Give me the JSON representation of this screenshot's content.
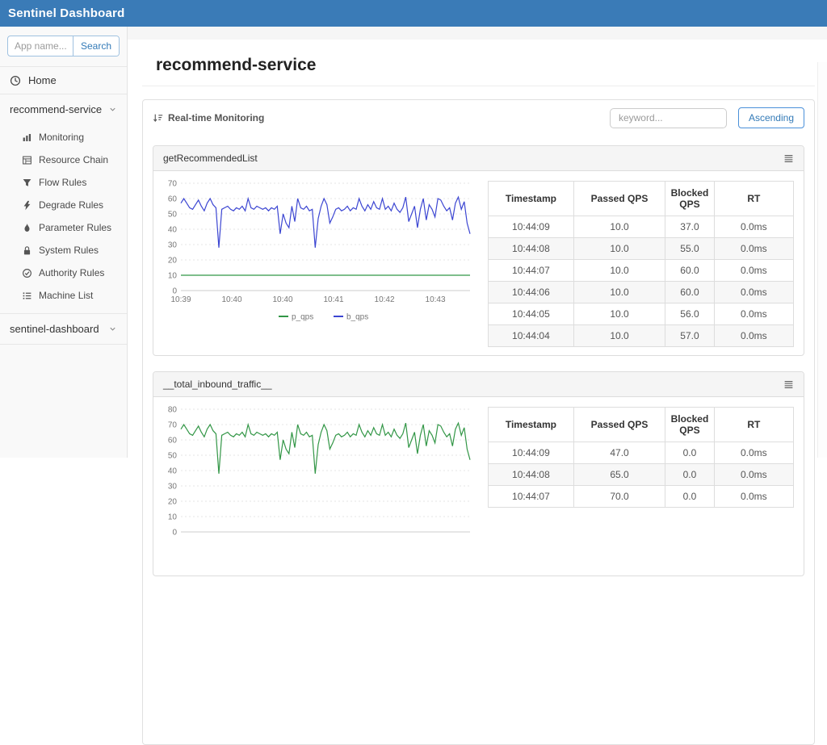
{
  "header": {
    "title": "Sentinel Dashboard"
  },
  "sidebar": {
    "search_placeholder": "App name...",
    "search_button": "Search",
    "home_label": "Home",
    "app_groups": [
      {
        "label": "recommend-service",
        "icon": "chevron-down",
        "expanded": true
      },
      {
        "label": "sentinel-dashboard",
        "icon": "chevron-down",
        "expanded": false
      }
    ],
    "menu_items": [
      {
        "label": "Monitoring",
        "icon": "bar-chart"
      },
      {
        "label": "Resource Chain",
        "icon": "table"
      },
      {
        "label": "Flow Rules",
        "icon": "funnel"
      },
      {
        "label": "Degrade Rules",
        "icon": "bolt"
      },
      {
        "label": "Parameter Rules",
        "icon": "flame"
      },
      {
        "label": "System Rules",
        "icon": "lock"
      },
      {
        "label": "Authority Rules",
        "icon": "check-circle"
      },
      {
        "label": "Machine List",
        "icon": "list"
      }
    ]
  },
  "main": {
    "page_title": "recommend-service",
    "toolbar": {
      "title": "Real-time Monitoring",
      "icon": "sort-amount-asc",
      "keyword_placeholder": "keyword...",
      "ascending_label": "Ascending"
    }
  },
  "panels": [
    {
      "title": "getRecommendedList",
      "menu_icon": "menu",
      "table": {
        "headers": [
          "Timestamp",
          "Passed QPS",
          "Blocked QPS",
          "RT"
        ],
        "rows": [
          [
            "10:44:09",
            "10.0",
            "37.0",
            "0.0ms"
          ],
          [
            "10:44:08",
            "10.0",
            "55.0",
            "0.0ms"
          ],
          [
            "10:44:07",
            "10.0",
            "60.0",
            "0.0ms"
          ],
          [
            "10:44:06",
            "10.0",
            "60.0",
            "0.0ms"
          ],
          [
            "10:44:05",
            "10.0",
            "56.0",
            "0.0ms"
          ],
          [
            "10:44:04",
            "10.0",
            "57.0",
            "0.0ms"
          ]
        ]
      }
    },
    {
      "title": "__total_inbound_traffic__",
      "menu_icon": "menu",
      "table": {
        "headers": [
          "Timestamp",
          "Passed QPS",
          "Blocked QPS",
          "RT"
        ],
        "rows": [
          [
            "10:44:09",
            "47.0",
            "0.0",
            "0.0ms"
          ],
          [
            "10:44:08",
            "65.0",
            "0.0",
            "0.0ms"
          ],
          [
            "10:44:07",
            "70.0",
            "0.0",
            "0.0ms"
          ]
        ]
      }
    }
  ],
  "chart_data": [
    {
      "type": "line",
      "title": "getRecommendedList QPS",
      "ylim": [
        0,
        70
      ],
      "yticks": [
        70,
        60,
        50,
        40,
        30,
        20,
        10,
        0
      ],
      "x_labels": [
        "10:39",
        "10:40",
        "10:40",
        "10:41",
        "10:42",
        "10:43"
      ],
      "grid": "dotted",
      "show_legend": true,
      "legend_position": "bottom",
      "series": [
        {
          "name": "p_qps",
          "color": "#329646",
          "values": [
            10,
            10
          ]
        },
        {
          "name": "b_qps",
          "color": "#3c46d2",
          "values": [
            57,
            60,
            57,
            54,
            53,
            56,
            59,
            55,
            52,
            57,
            60,
            56,
            54,
            28,
            53,
            54,
            55,
            53,
            52,
            54,
            53,
            55,
            52,
            60,
            54,
            53,
            55,
            54,
            53,
            54,
            52,
            54,
            53,
            55,
            37,
            50,
            44,
            41,
            55,
            45,
            60,
            54,
            53,
            55,
            52,
            53,
            28,
            47,
            55,
            60,
            56,
            44,
            48,
            53,
            54,
            52,
            53,
            55,
            52,
            54,
            53,
            60,
            55,
            52,
            56,
            53,
            58,
            54,
            53,
            60,
            53,
            55,
            52,
            57,
            53,
            51,
            54,
            61,
            45,
            50,
            55,
            41,
            53,
            60,
            46,
            56,
            53,
            48,
            60,
            59,
            55,
            52,
            54,
            46,
            57,
            61,
            53,
            58,
            44,
            37
          ]
        }
      ]
    },
    {
      "type": "line",
      "title": "__total_inbound_traffic__ QPS",
      "ylim": [
        0,
        80
      ],
      "yticks": [
        80,
        70,
        60,
        50,
        40,
        30,
        20,
        10,
        0
      ],
      "x_labels": [],
      "grid": "dotted",
      "show_legend": false,
      "series": [
        {
          "name": "p_qps",
          "color": "#329646",
          "values": [
            67,
            70,
            67,
            64,
            63,
            66,
            69,
            65,
            62,
            67,
            70,
            66,
            64,
            38,
            63,
            64,
            65,
            63,
            62,
            64,
            63,
            65,
            62,
            70,
            64,
            63,
            65,
            64,
            63,
            64,
            62,
            64,
            63,
            65,
            47,
            60,
            54,
            51,
            65,
            55,
            70,
            64,
            63,
            65,
            62,
            63,
            38,
            57,
            65,
            70,
            66,
            54,
            58,
            63,
            64,
            62,
            63,
            65,
            62,
            64,
            63,
            70,
            65,
            62,
            66,
            63,
            68,
            64,
            63,
            70,
            63,
            65,
            62,
            67,
            63,
            61,
            64,
            71,
            55,
            60,
            65,
            51,
            63,
            70,
            56,
            66,
            63,
            58,
            70,
            69,
            65,
            62,
            64,
            56,
            67,
            71,
            63,
            68,
            54,
            47
          ]
        }
      ]
    }
  ],
  "colors": {
    "header_bg": "#3a7bb7",
    "accent_blue": "#337ab7",
    "p_qps_green": "#329646",
    "b_qps_blue": "#3c46d2",
    "panel_header_bg": "#f5f5f5"
  }
}
